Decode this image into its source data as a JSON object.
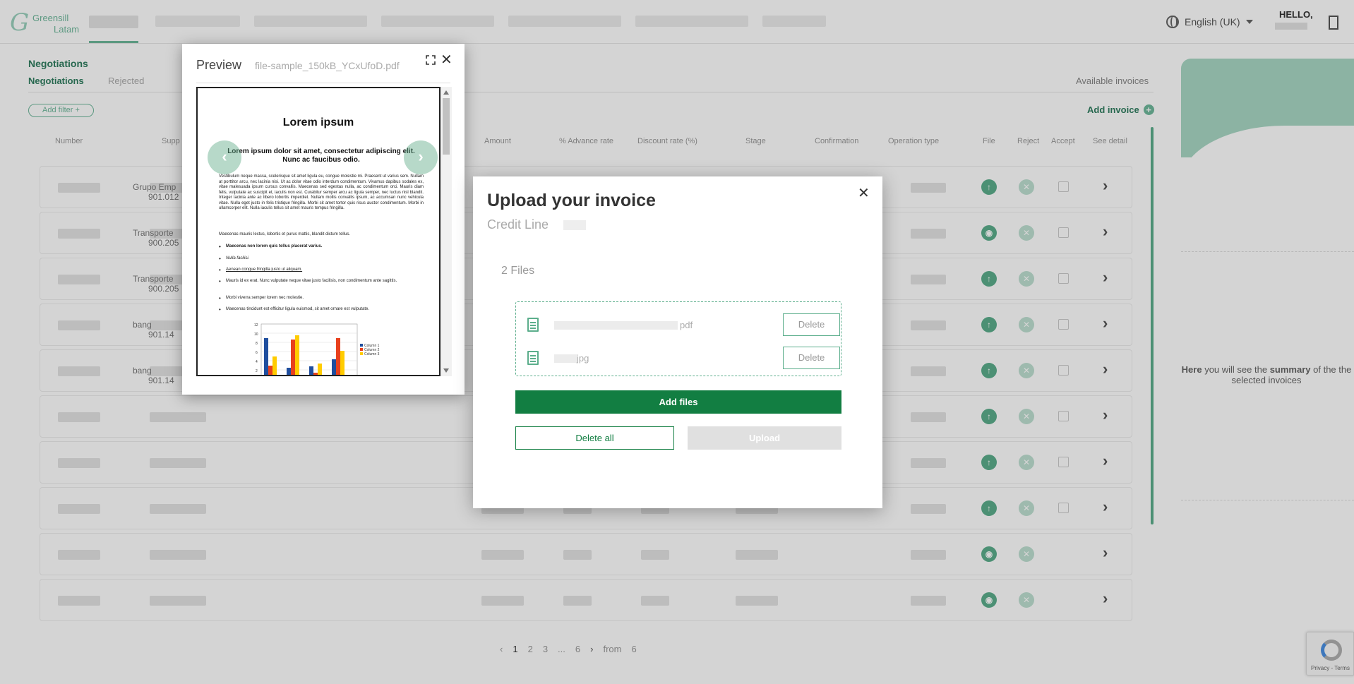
{
  "header": {
    "logo_text_1": "Greensill",
    "logo_text_2": "Latam",
    "language": "English (UK)",
    "greeting": "HELLO,"
  },
  "page": {
    "section_title": "Negotiations",
    "tabs": [
      "Negotiations",
      "Rejected"
    ],
    "available_invoices": "Available invoices",
    "add_filter": "Add filter +",
    "add_invoice": "Add invoice",
    "columns": [
      "Number",
      "Supp",
      "Amount",
      "% Advance rate",
      "Discount rate (%)",
      "Stage",
      "Confirmation",
      "Operation type",
      "File",
      "Reject",
      "Accept",
      "See detail"
    ],
    "rows": [
      {
        "supplier": "Grupo Emp",
        "id": "901.012",
        "file": "upload"
      },
      {
        "supplier": "Transporte",
        "id": "900.205",
        "file": "view"
      },
      {
        "supplier": "Transporte",
        "id": "900.205",
        "file": "upload"
      },
      {
        "supplier": "bang",
        "id": "901.14",
        "file": "upload"
      },
      {
        "supplier": "bang",
        "id": "901.14",
        "file": "upload"
      },
      {
        "supplier": "",
        "id": "",
        "file": "upload"
      },
      {
        "supplier": "",
        "id": "",
        "file": "upload"
      },
      {
        "supplier": "",
        "id": "",
        "file": "upload"
      },
      {
        "supplier": "",
        "id": "",
        "file": "view"
      },
      {
        "supplier": "",
        "id": "",
        "file": "view"
      }
    ],
    "pagination": {
      "pages": [
        "1",
        "2",
        "3",
        "...",
        "6"
      ],
      "from_label": "from",
      "total": "6"
    },
    "summary_text_bold": "Here",
    "summary_text_1": "you will see the",
    "summary_text_bold2": "summary",
    "summary_text_2": "of the the selected invoices",
    "recaptcha_links": "Privacy - Terms"
  },
  "preview": {
    "title": "Preview",
    "filename": "file-sample_150kB_YCxUfoD.pdf",
    "prev_icon": "chevron-left-icon",
    "next_icon": "chevron-right-icon",
    "doc": {
      "heading": "Lorem ipsum",
      "subheading": "Lorem ipsum dolor sit amet, consectetur adipiscing elit. Nunc ac faucibus odio.",
      "paragraph_1": "Vestibulum neque massa, scelerisque sit amet ligula eu, congue molestie mi. Praesent ut varius sem. Nullam at porttitor arcu, nec lacinia nisi. Ut ac dolor vitae odio interdum condimentum. Vivamus dapibus sodales ex, vitae malesuada ipsum cursus convallis. Maecenas sed egestas nulla, ac condimentum orci. Mauris diam felis, vulputate ac suscipit et, iaculis non est. Curabitur semper arcu ac ligula semper, nec luctus nisl blandit. Integer lacinia ante ac libero lobortis imperdiet. Nullam mollis convallis ipsum, ac accumsan nunc vehicula vitae. Nulla eget justo in felis tristique fringilla. Morbi sit amet tortor quis risus auctor condimentum. Morbi in ullamcorper elit. Nulla iaculis tellus sit amet mauris tempus fringilla.",
      "paragraph_2": "Maecenas mauris lectus, lobortis et purus mattis, blandit dictum tellus.",
      "bullets": [
        "Maecenas non lorem quis tellus placerat varius.",
        "Nulla facilisi.",
        "Aenean congue fringilla justo ut aliquam.",
        "Mauris id ex erat. Nunc vulputate neque vitae justo facilisis, non condimentum ante sagittis.",
        "Morbi viverra semper lorem nec molestie.",
        "Maecenas tincidunt est efficitur ligula euismod, sit amet ornare est vulputate."
      ],
      "chart_legend": [
        "Column 1",
        "Column 2",
        "Column 3"
      ],
      "chart_ticks": [
        "12",
        "10",
        "8",
        "6",
        "4",
        "2"
      ]
    }
  },
  "upload": {
    "title": "Upload your invoice",
    "subtitle": "Credit Line",
    "file_count": "2 Files",
    "files": [
      {
        "ext": "pdf",
        "delete_label": "Delete"
      },
      {
        "ext": "jpg",
        "delete_label": "Delete"
      }
    ],
    "add_files": "Add files",
    "delete_all": "Delete all",
    "upload": "Upload",
    "colors": {
      "primary": "#127e42",
      "accent": "#5cae8c",
      "disabled": "#e0e0e0"
    }
  }
}
